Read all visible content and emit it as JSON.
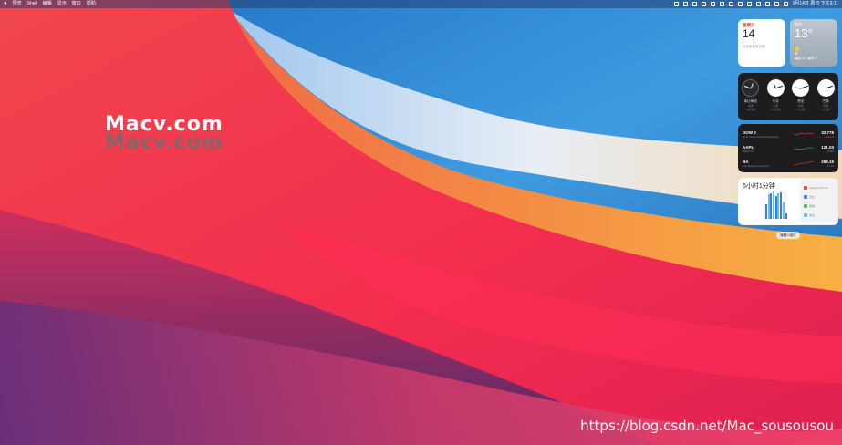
{
  "menubar": {
    "left": [
      "预览",
      "Shell",
      "编辑",
      "显示",
      "窗口",
      "帮助"
    ],
    "right": [
      "3月14日 周日 下午3:11"
    ]
  },
  "watermark": {
    "line1": "Macv.com",
    "line2": "Macv.com"
  },
  "url_watermark": "https://blog.csdn.net/Mac_sousousou",
  "widgets": {
    "calendar": {
      "weekday": "星期日",
      "day": "14",
      "note": "今天无更多日程"
    },
    "weather": {
      "city": "北京",
      "temp": "13°",
      "condition": "晴",
      "hl": "最高 16° 最低 2°"
    },
    "clocks": [
      {
        "name": "库比蒂诺",
        "day": "今天",
        "offset": "-16小时"
      },
      {
        "name": "东京",
        "day": "今天",
        "offset": "+1小时"
      },
      {
        "name": "悉尼",
        "day": "今天",
        "offset": "+3小时"
      },
      {
        "name": "巴黎",
        "day": "今天",
        "offset": "-7小时"
      }
    ],
    "stocks": [
      {
        "symbol": "DOW J",
        "name": "Dow Jones Industrial Average",
        "price": "32,778",
        "change": "+293.05",
        "up": false
      },
      {
        "symbol": "AAPL",
        "name": "Apple Inc.",
        "price": "121.03",
        "change": "+0.94",
        "up": true
      },
      {
        "symbol": "BA",
        "name": "The Boeing Company",
        "price": "269.19",
        "change": "+17.90",
        "up": false
      }
    ],
    "screen_time": {
      "total": "6小时1分钟",
      "bars": [
        0.55,
        0.9,
        0.95,
        1.0,
        0.85,
        0.92,
        0.97,
        0.6,
        0.2
      ],
      "apps": [
        "Google Chrome",
        "访达",
        "微信",
        "信息"
      ]
    }
  },
  "edit_button": "编辑小组件",
  "colors": {
    "calendar_accent": "#e0443a",
    "bar_primary": "#3b7de8",
    "bar_secondary": "#5fc1e8",
    "stock_down": "#e84a3f",
    "stock_up": "#3cc35b"
  }
}
